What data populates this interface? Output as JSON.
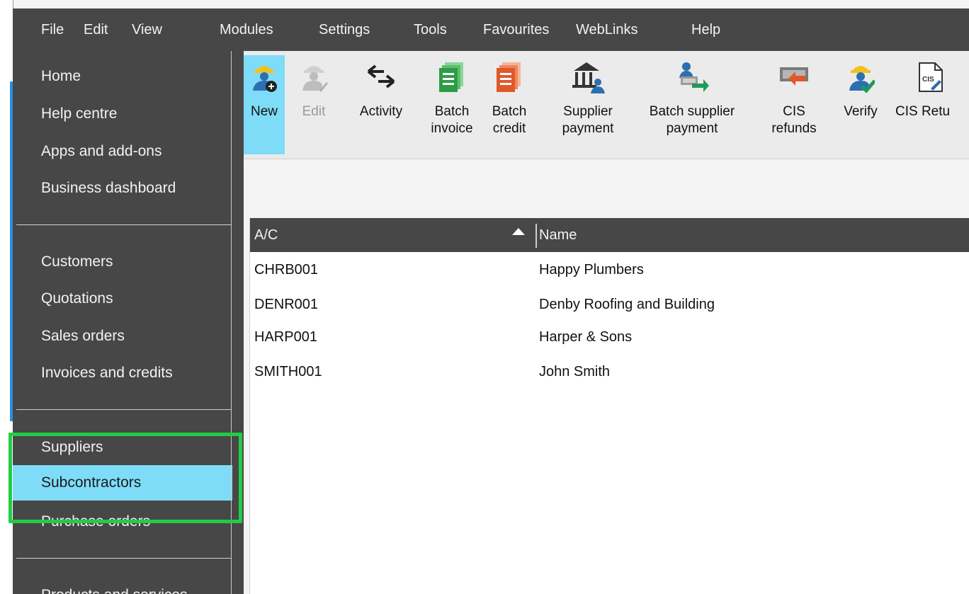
{
  "menu": [
    "File",
    "Edit",
    "View",
    "Modules",
    "Settings",
    "Tools",
    "Favourites",
    "WebLinks",
    "Help"
  ],
  "sidebar": {
    "group1": [
      "Home",
      "Help centre",
      "Apps and add-ons",
      "Business dashboard"
    ],
    "group2": [
      "Customers",
      "Quotations",
      "Sales orders",
      "Invoices and credits"
    ],
    "group3": [
      "Suppliers",
      "Subcontractors",
      "Purchase orders"
    ],
    "group4": [
      "Products and services"
    ],
    "selected": "Subcontractors"
  },
  "toolbar": {
    "buttons": [
      {
        "line1": "New",
        "line2": "",
        "icon": "worker-add-icon",
        "state": "active"
      },
      {
        "line1": "Edit",
        "line2": "",
        "icon": "worker-edit-icon",
        "state": "disabled"
      },
      {
        "line1": "Activity",
        "line2": "",
        "icon": "activity-arrows-icon",
        "state": "normal"
      },
      {
        "line1": "Batch",
        "line2": "invoice",
        "icon": "batch-invoice-icon",
        "state": "normal"
      },
      {
        "line1": "Batch",
        "line2": "credit",
        "icon": "batch-credit-icon",
        "state": "normal"
      },
      {
        "line1": "Supplier",
        "line2": "payment",
        "icon": "bank-payment-icon",
        "state": "normal"
      },
      {
        "line1": "Batch supplier",
        "line2": "payment",
        "icon": "batch-payment-icon",
        "state": "normal"
      },
      {
        "line1": "CIS",
        "line2": "refunds",
        "icon": "refund-icon",
        "state": "normal"
      },
      {
        "line1": "Verify",
        "line2": "",
        "icon": "worker-verify-icon",
        "state": "normal"
      },
      {
        "line1": "CIS Retu",
        "line2": "",
        "icon": "cis-document-icon",
        "state": "normal"
      }
    ]
  },
  "grid": {
    "columns": [
      "A/C",
      "Name"
    ],
    "rows": [
      {
        "ac": "CHRB001",
        "name": "Happy Plumbers"
      },
      {
        "ac": "DENR001",
        "name": "Denby Roofing and Building"
      },
      {
        "ac": "HARP001",
        "name": "Harper & Sons"
      },
      {
        "ac": "SMITH001",
        "name": "John Smith"
      }
    ]
  },
  "colors": {
    "chrome": "#474747",
    "selection": "#7fdcf8",
    "highlight": "#22cc44",
    "accent": "#2a8fe0"
  }
}
